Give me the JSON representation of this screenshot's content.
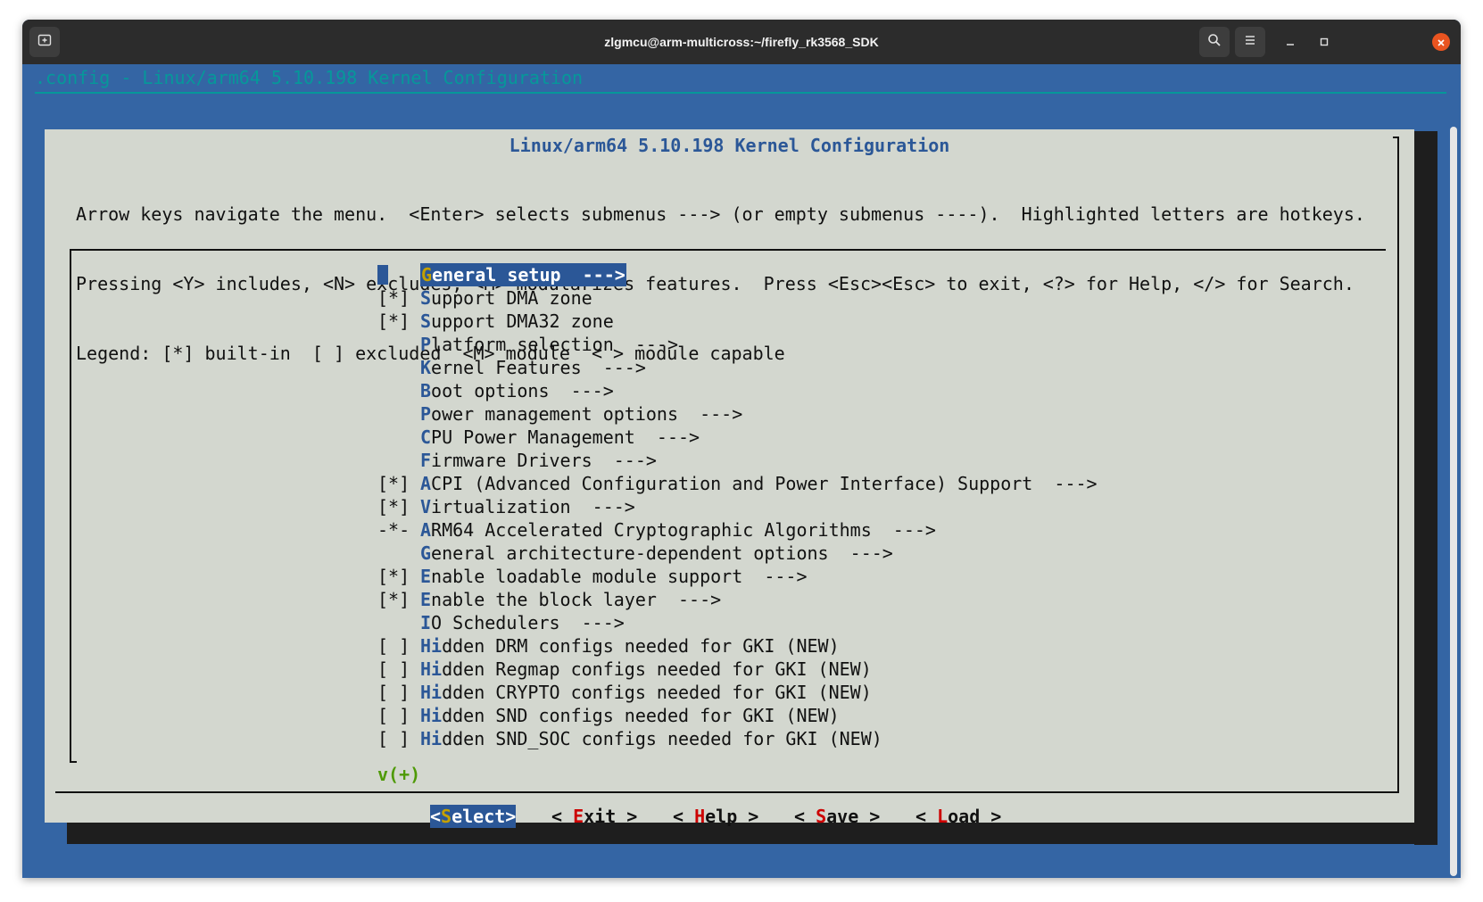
{
  "window": {
    "title": "zlgmcu@arm-multicross:~/firefly_rk3568_SDK"
  },
  "terminal": {
    "top_line": ".config - Linux/arm64 5.10.198 Kernel Configuration"
  },
  "dialog": {
    "title": "Linux/arm64 5.10.198 Kernel Configuration",
    "help_lines": [
      "Arrow keys navigate the menu.  <Enter> selects submenus ---> (or empty submenus ----).  Highlighted letters are hotkeys.",
      "Pressing <Y> includes, <N> excludes, <M> modularizes features.  Press <Esc><Esc> to exit, <?> for Help, </> for Search.",
      "Legend: [*] built-in  [ ] excluded  <M> module  < > module capable"
    ],
    "menu_items": [
      {
        "prefix": "",
        "hotkey": "G",
        "rest": "eneral setup  --->",
        "selected": true
      },
      {
        "prefix": "[*]",
        "hotkey": "S",
        "rest": "upport DMA zone"
      },
      {
        "prefix": "[*]",
        "hotkey": "S",
        "rest": "upport DMA32 zone"
      },
      {
        "prefix": "",
        "hotkey": "P",
        "rest": "latform selection  --->"
      },
      {
        "prefix": "",
        "hotkey": "K",
        "rest": "ernel Features  --->"
      },
      {
        "prefix": "",
        "hotkey": "B",
        "rest": "oot options  --->"
      },
      {
        "prefix": "",
        "hotkey": "P",
        "rest": "ower management options  --->"
      },
      {
        "prefix": "",
        "hotkey": "C",
        "rest": "PU Power Management  --->"
      },
      {
        "prefix": "",
        "hotkey": "F",
        "rest": "irmware Drivers  --->"
      },
      {
        "prefix": "[*]",
        "hotkey": "A",
        "rest": "CPI (Advanced Configuration and Power Interface) Support  --->"
      },
      {
        "prefix": "[*]",
        "hotkey": "V",
        "rest": "irtualization  --->"
      },
      {
        "prefix": "-*-",
        "hotkey": "A",
        "rest": "RM64 Accelerated Cryptographic Algorithms  --->"
      },
      {
        "prefix": "",
        "hotkey": "G",
        "rest": "eneral architecture-dependent options  --->"
      },
      {
        "prefix": "[*]",
        "hotkey": "E",
        "rest": "nable loadable module support  --->"
      },
      {
        "prefix": "[*]",
        "hotkey": "E",
        "rest": "nable the block layer  --->"
      },
      {
        "prefix": "",
        "hotkey": "I",
        "rest": "O Schedulers  --->"
      },
      {
        "prefix": "[ ]",
        "hotkey": "Hi",
        "rest": "dden DRM configs needed for GKI (NEW)"
      },
      {
        "prefix": "[ ]",
        "hotkey": "Hi",
        "rest": "dden Regmap configs needed for GKI (NEW)"
      },
      {
        "prefix": "[ ]",
        "hotkey": "Hi",
        "rest": "dden CRYPTO configs needed for GKI (NEW)"
      },
      {
        "prefix": "[ ]",
        "hotkey": "Hi",
        "rest": "dden SND configs needed for GKI (NEW)"
      },
      {
        "prefix": "[ ]",
        "hotkey": "Hi",
        "rest": "dden SND_SOC configs needed for GKI (NEW)"
      }
    ],
    "more_indicator": "v(+)",
    "buttons": {
      "select": {
        "pre": "<",
        "hot": "S",
        "post": "elect>"
      },
      "exit": {
        "pre": "< ",
        "hot": "E",
        "post": "xit >"
      },
      "help": {
        "pre": "< ",
        "hot": "H",
        "post": "elp >"
      },
      "save": {
        "pre": "< ",
        "hot": "S",
        "post": "ave >"
      },
      "load": {
        "pre": "< ",
        "hot": "L",
        "post": "oad >"
      }
    }
  },
  "colors": {
    "terminal_bg": "#3465a4",
    "dialog_bg": "#d3d7cf",
    "hotkey": "#2b5797",
    "button_hotkey": "#cc0000",
    "more_indicator": "#4e9a06",
    "top_line": "#06989a",
    "close_button": "#e95420"
  },
  "icons": {
    "new_tab": "new-tab-icon",
    "search": "search-icon",
    "menu": "hamburger-menu-icon",
    "minimize": "minimize-icon",
    "maximize": "maximize-icon",
    "close": "close-icon"
  }
}
